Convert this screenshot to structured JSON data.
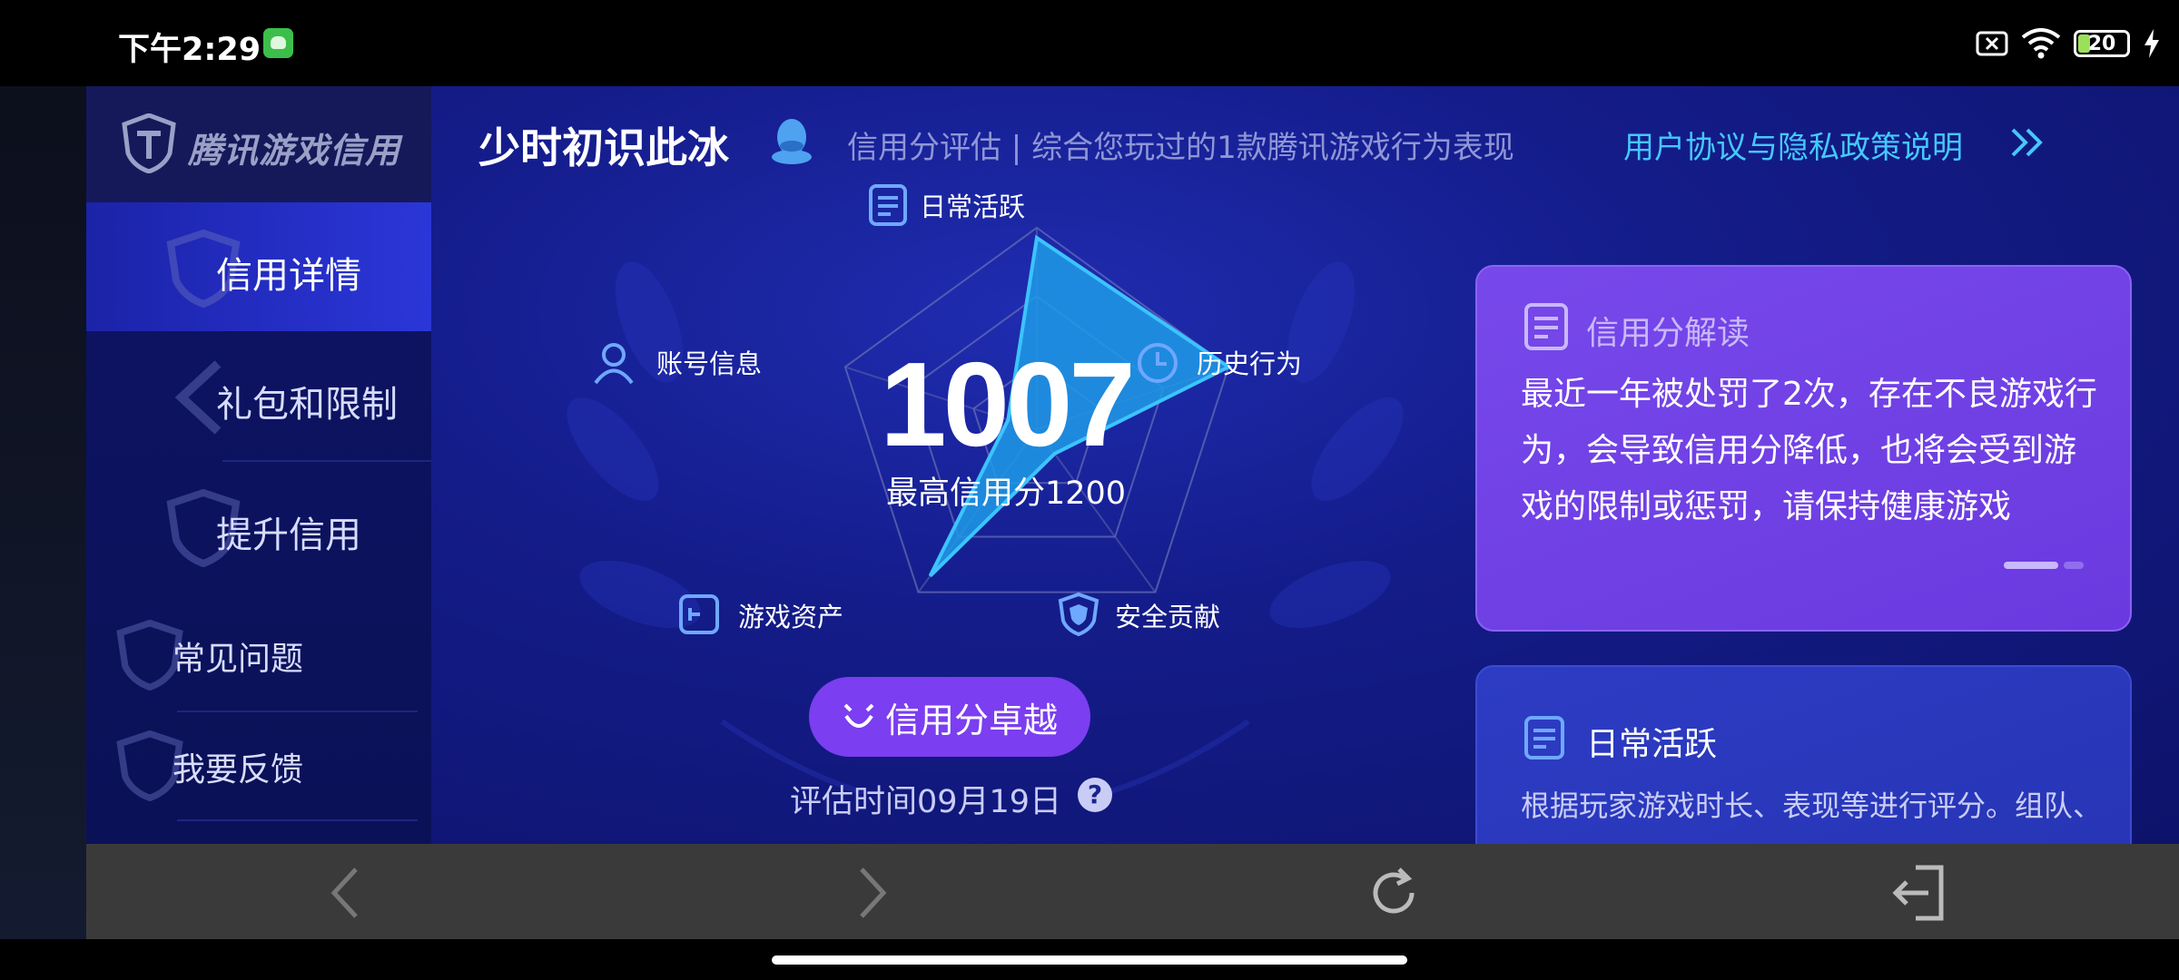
{
  "status_bar": {
    "time": "下午2:29",
    "battery": "20",
    "icons": [
      "app-notification-icon",
      "sim-off-icon",
      "wifi-icon",
      "battery-icon",
      "charging-icon"
    ]
  },
  "sidebar": {
    "brand": "腾讯游戏信用",
    "items": [
      {
        "label": "信用详情",
        "active": true
      },
      {
        "label": "礼包和限制",
        "active": false
      },
      {
        "label": "提升信用",
        "active": false
      }
    ],
    "sub_items": [
      {
        "label": "常见问题"
      },
      {
        "label": "我要反馈"
      }
    ]
  },
  "header": {
    "player_name": "少时初识此冰",
    "description": "信用分评估 | 综合您玩过的1款腾讯游戏行为表现",
    "link": "用户协议与隐私政策说明"
  },
  "radar": {
    "axes": [
      "日常活跃",
      "历史行为",
      "安全贡献",
      "游戏资产",
      "账号信息"
    ],
    "score": "1007",
    "max_score": "最高信用分1200",
    "level_button": "信用分卓越",
    "eval_time": "评估时间09月19日",
    "help": "?"
  },
  "chart_data": {
    "type": "radar",
    "categories": [
      "日常活跃",
      "历史行为",
      "安全贡献",
      "游戏资产",
      "账号信息"
    ],
    "values": [
      0.95,
      1.0,
      0.15,
      0.9,
      0.15
    ],
    "max": 1
  },
  "cards": {
    "interpretation": {
      "title": "信用分解读",
      "text": "最近一年被处罚了2次，存在不良游戏行为，会导致信用分降低，也将会受到游戏的限制或惩罚，请保持健康游戏"
    },
    "daily": {
      "title": "日常活跃",
      "text": "根据玩家游戏时长、表现等进行评分。组队、"
    }
  },
  "colors": {
    "accent_purple": "#7b3ef0",
    "link_cyan": "#45c8ff",
    "background_blue": "#141c8a"
  }
}
